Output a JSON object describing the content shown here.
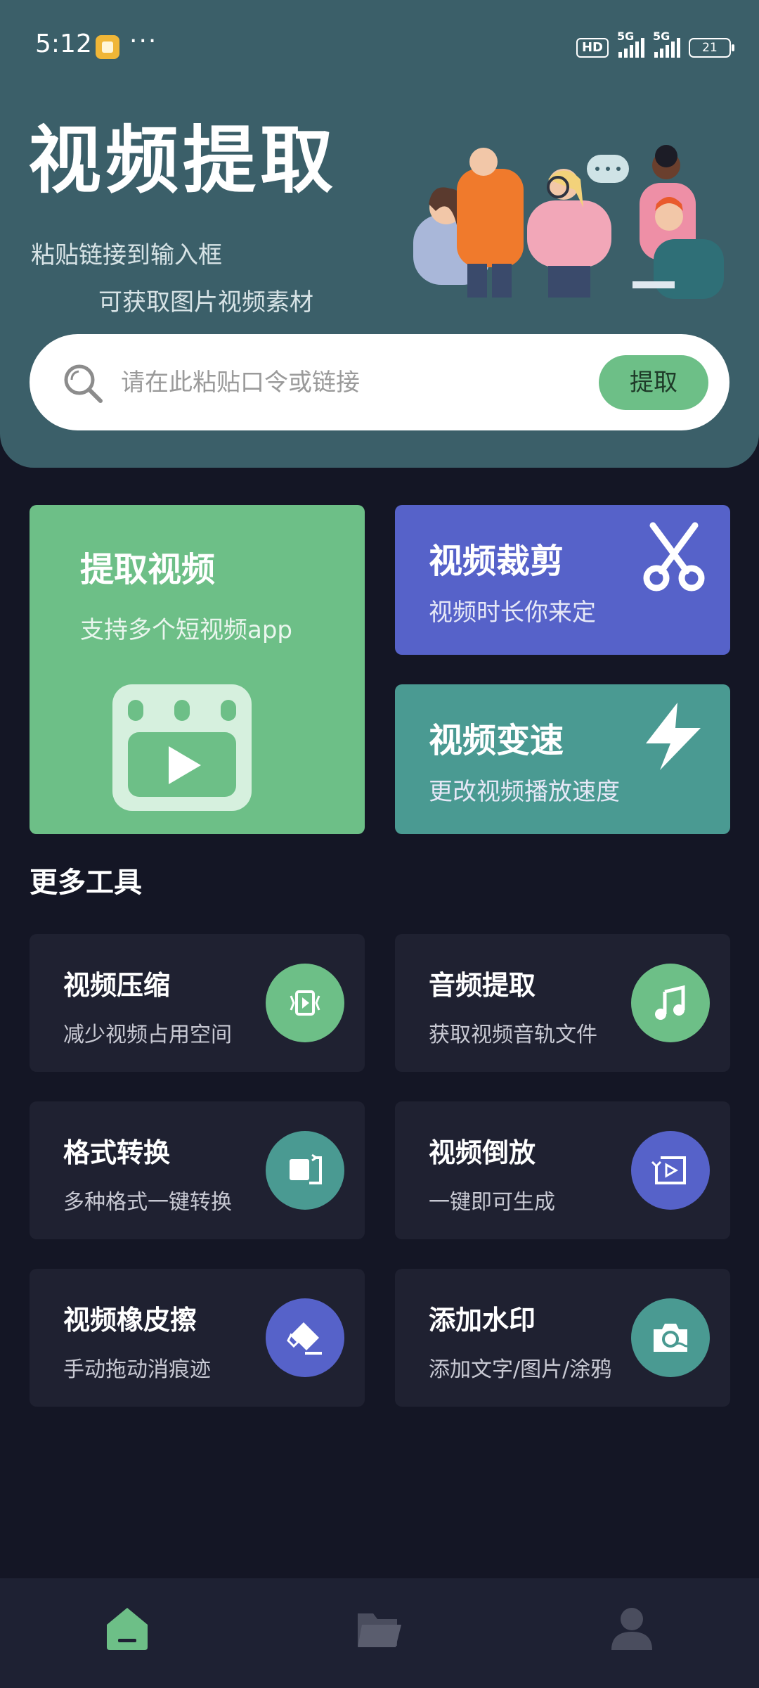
{
  "status_bar": {
    "time": "5:12",
    "more": "···",
    "hd_label": "HD",
    "network_1": "5G",
    "network_2": "5G",
    "battery": "21"
  },
  "header": {
    "title": "视频提取",
    "subtitle_1": "粘贴链接到输入框",
    "subtitle_2": "可获取图片视频素材"
  },
  "search": {
    "placeholder": "请在此粘贴口令或链接",
    "value": "",
    "button_label": "提取"
  },
  "feature_cards": [
    {
      "title": "提取视频",
      "subtitle": "支持多个短视频app",
      "icon": "video-player-icon",
      "color": "#6dbf87"
    },
    {
      "title": "视频裁剪",
      "subtitle": "视频时长你来定",
      "icon": "scissors-icon",
      "color": "#5662c9"
    },
    {
      "title": "视频变速",
      "subtitle": "更改视频播放速度",
      "icon": "lightning-icon",
      "color": "#4a9a92"
    }
  ],
  "more_tools": {
    "title": "更多工具",
    "items": [
      {
        "title": "视频压缩",
        "subtitle": "减少视频占用空间",
        "icon": "compress-video-icon",
        "color": "#6dbf87"
      },
      {
        "title": "音频提取",
        "subtitle": "获取视频音轨文件",
        "icon": "music-note-icon",
        "color": "#6dbf87"
      },
      {
        "title": "格式转换",
        "subtitle": "多种格式一键转换",
        "icon": "convert-icon",
        "color": "#4a9a92"
      },
      {
        "title": "视频倒放",
        "subtitle": "一键即可生成",
        "icon": "reverse-play-icon",
        "color": "#5662c9"
      },
      {
        "title": "视频橡皮擦",
        "subtitle": "手动拖动消痕迹",
        "icon": "eraser-icon",
        "color": "#5662c9"
      },
      {
        "title": "添加水印",
        "subtitle": "添加文字/图片/涂鸦",
        "icon": "camera-watermark-icon",
        "color": "#4a9a92"
      }
    ]
  },
  "bottom_nav": [
    {
      "icon": "home-icon",
      "active": true,
      "color": "#6dbf87"
    },
    {
      "icon": "folder-icon",
      "active": false,
      "color": "#4a4d5e"
    },
    {
      "icon": "profile-icon",
      "active": false,
      "color": "#4a4d5e"
    }
  ]
}
